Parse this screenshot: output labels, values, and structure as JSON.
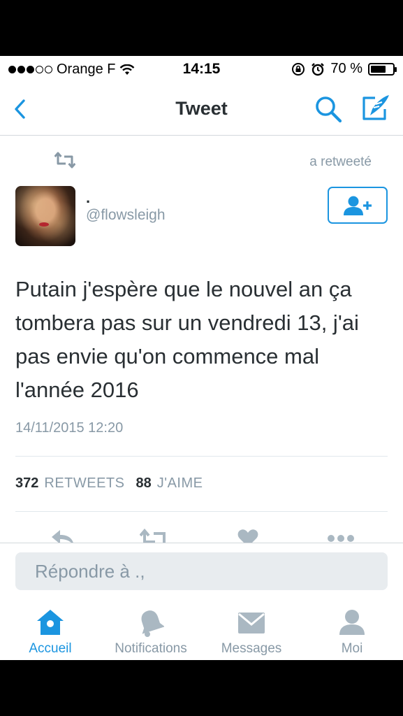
{
  "status_bar": {
    "carrier": "Orange F",
    "time": "14:15",
    "battery": "70 %",
    "battery_level": 0.7,
    "signal_bars_filled": 3,
    "signal_bars_total": 5
  },
  "navbar": {
    "title": "Tweet",
    "back_icon": "chevron-left-icon",
    "search_icon": "search-icon",
    "compose_icon": "compose-icon"
  },
  "retweet": {
    "label": "a retweeté",
    "icon": "retweet-icon"
  },
  "author": {
    "name": ".",
    "handle": "@flowsleigh",
    "follow_icon": "follow-user-icon"
  },
  "tweet": {
    "text": "Putain j'espère que le nouvel an ça tombera pas sur un vendredi 13, j'ai pas envie qu'on commence mal l'année 2016",
    "timestamp": "14/11/2015 12:20"
  },
  "stats": {
    "retweets_count": "372",
    "retweets_label": "RETWEETS",
    "likes_count": "88",
    "likes_label": "J'AIME"
  },
  "reply": {
    "placeholder": "Répondre à .,"
  },
  "tabbar": {
    "items": [
      {
        "label": "Accueil",
        "icon": "home-icon",
        "active": true
      },
      {
        "label": "Notifications",
        "icon": "bell-icon",
        "active": false
      },
      {
        "label": "Messages",
        "icon": "envelope-icon",
        "active": false
      },
      {
        "label": "Moi",
        "icon": "person-icon",
        "active": false
      }
    ]
  },
  "colors": {
    "accent": "#1b95e0",
    "text": "#292f33",
    "muted": "#8899a6",
    "icon_gray": "#aab8c2"
  }
}
